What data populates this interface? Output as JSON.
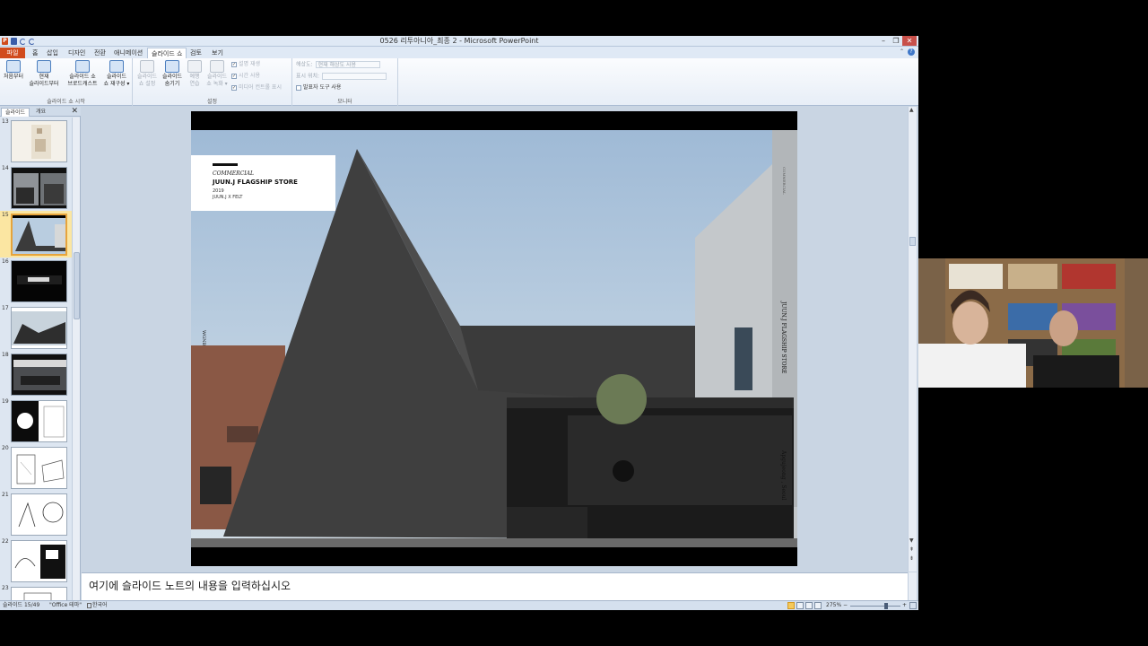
{
  "window": {
    "title": "0526 리투아니아_최종 2 - Microsoft PowerPoint",
    "app_badge": "P",
    "controls": {
      "minimize": "–",
      "restore": "❐",
      "close": "✕"
    }
  },
  "ribbon_tabs": [
    "파일",
    "홈",
    "삽입",
    "디자인",
    "전환",
    "애니메이션",
    "슬라이드 쇼",
    "검토",
    "보기"
  ],
  "ribbon_active_tab": "슬라이드 쇼",
  "ribbon": {
    "start_group": {
      "label": "슬라이드 쇼 시작",
      "from_beginning": "처음부터",
      "from_current": "현재\n슬라이드부터",
      "broadcast": "슬라이드 쇼\n브로드캐스트",
      "custom_show": "슬라이드\n쇼 재구성 ▾"
    },
    "setup_group": {
      "label": "설정",
      "setup_show": "슬라이드\n쇼 설정",
      "hide_slide": "슬라이드\n숨기기",
      "rehearse": "예행\n연습",
      "record": "슬라이드\n쇼 녹화 ▾",
      "play_narration": "설명 재생",
      "use_timings": "시간 사용",
      "show_media_controls": "미디어 컨트롤 표시"
    },
    "monitor_group": {
      "label": "모니터",
      "resolution_label": "해상도:",
      "resolution_value": "현재 해상도 사용",
      "show_on_label": "표시 위치:",
      "show_on_value": "",
      "presenter_view": "발표자 도구 사용"
    }
  },
  "panel": {
    "tab_slides": "슬라이드",
    "tab_outline": "개요",
    "close": "✕",
    "slide_numbers": [
      "13",
      "14",
      "15",
      "16",
      "17",
      "18",
      "19",
      "20",
      "21",
      "22",
      "23"
    ],
    "selected_slide": "15"
  },
  "slide": {
    "category": "COMMERCIAL",
    "project": "JUUN.J FLAGSHIP STORE",
    "year": "2019",
    "credit": "JUUN.J X FELT",
    "vertical_left": "WGNB",
    "vertical_right_top": "COMMERCIAL",
    "vertical_right_mid": "JUUN.J FLAGSHIP STORE",
    "vertical_right_bottom": "Apgujeong , Seoul"
  },
  "notes": {
    "placeholder": "여기에 슬라이드 노트의 내용을 입력하십시오"
  },
  "status": {
    "slide_info": "슬라이드 15/49",
    "theme": "\"Office 테마\"",
    "language": "한국어",
    "zoom": "275%",
    "zoom_minus": "−",
    "zoom_plus": "+"
  },
  "colors": {
    "file_tab": "#d14b1d",
    "selected_thumb": "#fbe6a2",
    "app_background": "#c9d5e3"
  }
}
